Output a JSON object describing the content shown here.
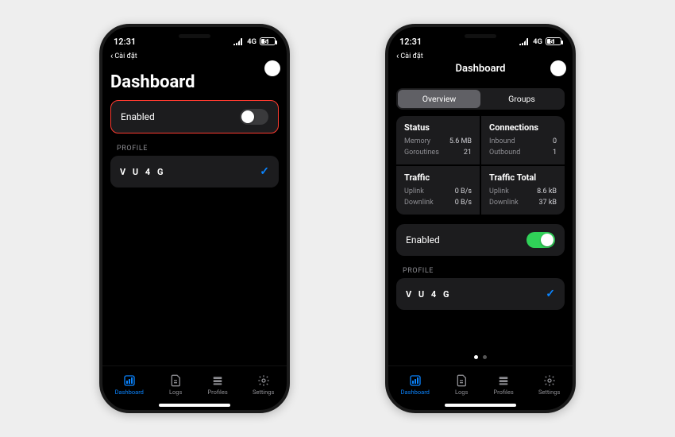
{
  "status": {
    "time": "12:31",
    "net": "4G",
    "battery_pct": "51",
    "back_label": "Cài đặt"
  },
  "left": {
    "title": "Dashboard",
    "enabled_label": "Enabled",
    "profile_section": "PROFILE",
    "profile_name": "V U 4 G"
  },
  "right": {
    "nav_title": "Dashboard",
    "seg": [
      "Overview",
      "Groups"
    ],
    "stats": {
      "status": {
        "head": "Status",
        "memory_k": "Memory",
        "memory_v": "5.6 MB",
        "goroutines_k": "Goroutines",
        "goroutines_v": "21"
      },
      "connections": {
        "head": "Connections",
        "inbound_k": "Inbound",
        "inbound_v": "0",
        "outbound_k": "Outbound",
        "outbound_v": "1"
      },
      "traffic": {
        "head": "Traffic",
        "uplink_k": "Uplink",
        "uplink_v": "0 B/s",
        "downlink_k": "Downlink",
        "downlink_v": "0 B/s"
      },
      "traffic_total": {
        "head": "Traffic Total",
        "uplink_k": "Uplink",
        "uplink_v": "8.6 kB",
        "downlink_k": "Downlink",
        "downlink_v": "37 kB"
      }
    },
    "enabled_label": "Enabled",
    "profile_section": "PROFILE",
    "profile_name": "V U 4 G"
  },
  "tabs": {
    "dashboard": "Dashboard",
    "logs": "Logs",
    "profiles": "Profiles",
    "settings": "Settings"
  }
}
